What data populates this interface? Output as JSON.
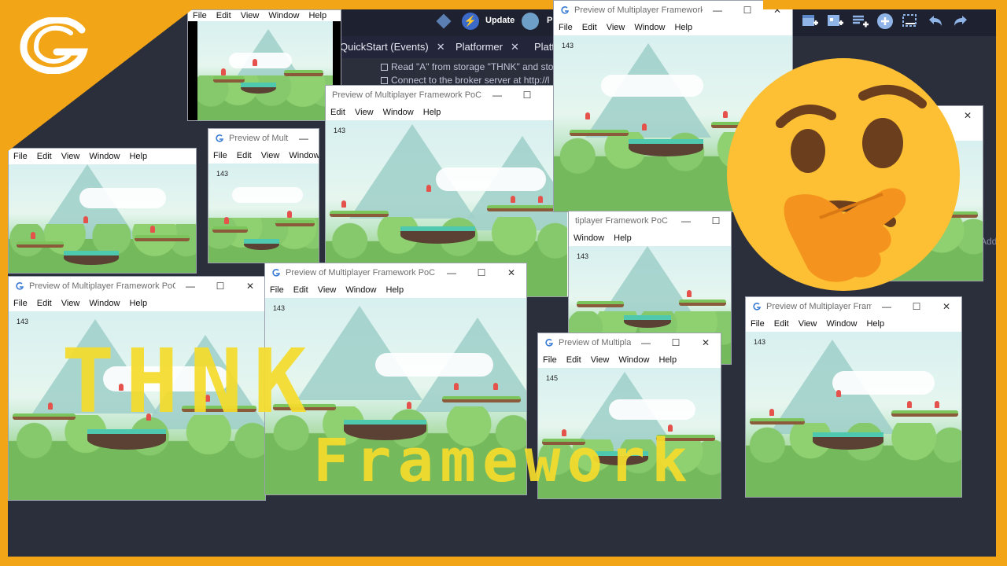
{
  "colors": {
    "frame": "#f2a516",
    "editor_bg": "#2b2e3b",
    "title_text": "#f5dc2d",
    "accent": "#3b6ac8"
  },
  "editor": {
    "update_label": "Update",
    "pr_label": "P",
    "tabs": [
      {
        "label": "QuickStart (Events)",
        "close": "✕"
      },
      {
        "label": "Platformer",
        "close": "✕"
      },
      {
        "label": "Platt"
      }
    ],
    "events": [
      "Read \"A\" from storage \"THNK\" and stor",
      "Connect to the broker server at http://l"
    ],
    "toolbar_icons": [
      "add-scene-icon",
      "add-object-icon",
      "add-event-icon",
      "add-circle-icon",
      "layout-icon",
      "undo-icon",
      "redo-icon"
    ],
    "side_label": "Add"
  },
  "window": {
    "title": "Preview of Multiplayer Framework PoC",
    "title_short": "Preview of Multiplayer Framework ...",
    "title_short2": "Preview of Multiplayer Fram...",
    "title_short3": "Preview of Multipla...",
    "title_short4": "Preview of Multi...",
    "title_partial": "tiplayer Framework PoC",
    "menu": [
      "File",
      "Edit",
      "View",
      "Window",
      "Help"
    ],
    "fps": "143",
    "fps_alt": "145",
    "minimize": "—",
    "maximize": "☐",
    "close": "✕"
  },
  "overlay": {
    "line1": "THNK",
    "line2": "Framework"
  },
  "icons": {
    "logo": "gdevelop-logo",
    "emoji": "thinking-face-emoji",
    "window_icon": "gdevelop-window-icon"
  }
}
